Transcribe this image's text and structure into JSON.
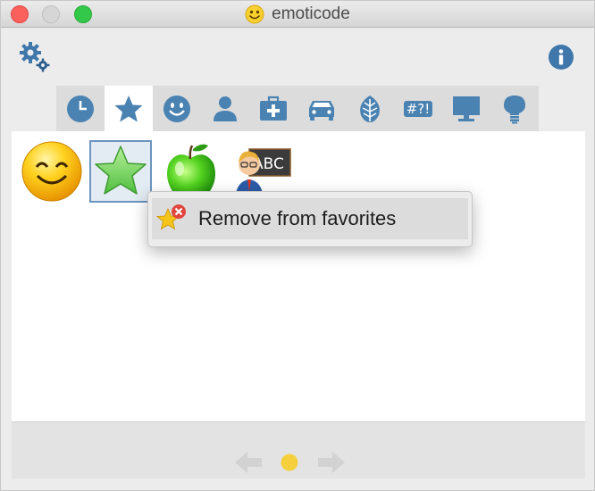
{
  "window": {
    "title": "emoticode",
    "title_icon": "smiley-face-icon"
  },
  "toolbar": {
    "settings_icon": "gears-icon",
    "info_icon": "info-icon"
  },
  "tabs": [
    {
      "name": "recent",
      "icon": "clock-icon",
      "active": false
    },
    {
      "name": "favorites",
      "icon": "star-icon",
      "active": true
    },
    {
      "name": "smileys",
      "icon": "smiley-icon",
      "active": false
    },
    {
      "name": "people",
      "icon": "person-icon",
      "active": false
    },
    {
      "name": "medical",
      "icon": "first-aid-kit-icon",
      "active": false
    },
    {
      "name": "travel",
      "icon": "car-icon",
      "active": false
    },
    {
      "name": "nature",
      "icon": "leaf-icon",
      "active": false
    },
    {
      "name": "symbols",
      "icon": "symbols-text-icon",
      "label": "#?!",
      "active": false
    },
    {
      "name": "objects",
      "icon": "monitor-icon",
      "active": false
    },
    {
      "name": "ideas",
      "icon": "lightbulb-icon",
      "active": false
    }
  ],
  "favorites": [
    {
      "icon": "smiling-face-emoji",
      "selected": false
    },
    {
      "icon": "green-star-emoji",
      "selected": true
    },
    {
      "icon": "green-apple-emoji",
      "selected": false
    },
    {
      "icon": "teacher-abc-emoji",
      "selected": false
    }
  ],
  "context_menu": {
    "item_label": "Remove from favorites",
    "item_icon": "star-remove-icon"
  },
  "pager": {
    "prev_icon": "arrow-left-icon",
    "next_icon": "arrow-right-icon",
    "page_dot_color": "#f5cf3c"
  },
  "colors": {
    "accent": "#4a82b2",
    "selection_border": "#6b95c0"
  }
}
